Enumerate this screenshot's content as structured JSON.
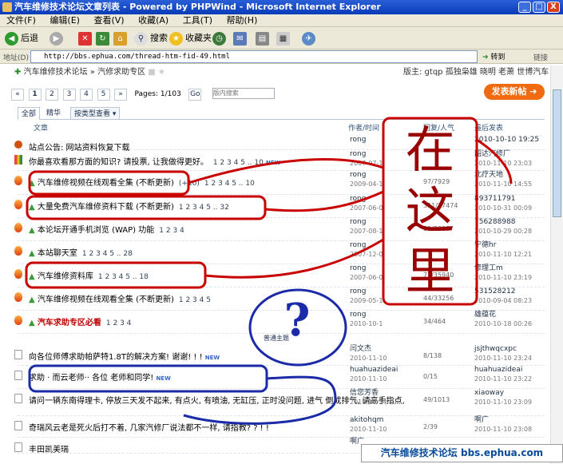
{
  "window": {
    "title": "汽车维修技术论坛文章列表 - Powered by PHPWind - Microsoft Internet Explorer",
    "min": "_",
    "max": "□",
    "close": "X"
  },
  "menu": [
    "文件(F)",
    "编辑(E)",
    "查看(V)",
    "收藏(A)",
    "工具(T)",
    "帮助(H)"
  ],
  "toolbar": {
    "back": "后退",
    "search": "搜索",
    "favorites": "收藏夹"
  },
  "address": {
    "label": "地址(D)",
    "url": "http://bbs.ephua.com/thread-htm-fid-49.html",
    "go": "转到",
    "links": "链接"
  },
  "breadcrumb": {
    "forum": "汽车维修技术论坛",
    "sep": "»",
    "board": "汽修求助专区"
  },
  "moderators": "版主: gtqp 孤独枭雄 晓明 老萧 世博汽车",
  "pager": {
    "pages": [
      "1",
      "2",
      "3",
      "4",
      "5"
    ],
    "next": "»",
    "info": "Pages: 1/103",
    "go": "Go",
    "search_placeholder": "版内搜索"
  },
  "new_post": "发表新帖",
  "tabs": {
    "all": "全部",
    "digest": "精华",
    "by_type": "按类型查看"
  },
  "headers": {
    "article": "文章",
    "author": "作者/时间",
    "replies": "回复/人气",
    "last": "最后发表"
  },
  "rows": [
    {
      "title": "站点公告: 网站资料恢复下载",
      "author": "rong",
      "date": "",
      "replies": "",
      "last_user": "2010-10-10 19:25",
      "last_date": ""
    },
    {
      "title": "你最喜欢看那方面的知识? 请投票, 让我做得更好。",
      "pages": "1 2 3 4 5 .. 10",
      "author": "rong",
      "date": "2007-07-1",
      "replies": "",
      "last_user": "韶达汽修厂",
      "last_date": "2010-11-10 23:03"
    },
    {
      "title": "汽车维修视频在线观看全集 (不断更新)",
      "extra": "(+10)",
      "pages": "1 2 3 4 5 .. 10",
      "author": "rong",
      "date": "2009-04-1",
      "replies": "97/7929",
      "last_user": "北疗天地",
      "last_date": "2010-11-10 14:55"
    },
    {
      "title": "大量免费汽车维修资料下载 (不断更新)",
      "pages": "1 2 3 4 5 .. 32",
      "author": "rong",
      "date": "2007-06-0",
      "replies": "311/27474",
      "last_user": "893711791",
      "last_date": "2010-10-31 00:09"
    },
    {
      "title": "本论坛开通手机浏览 (WAP) 功能",
      "pages": "1 2 3 4",
      "author": "rong",
      "date": "2007-08-1",
      "replies": "31/3337",
      "last_user": "756288988",
      "last_date": "2010-10-29 00:28"
    },
    {
      "title": "本站聊天室",
      "pages": "1 2 3 4 5 .. 28",
      "author": "rong",
      "date": "2007-12-0",
      "replies": "",
      "last_user": "宁德hr",
      "last_date": "2010-11-10 12:21"
    },
    {
      "title": "汽车维修资料库",
      "pages": "1 2 3 4 5 .. 18",
      "author": "rong",
      "date": "2007-06-0",
      "replies": "77/35940",
      "last_user": "修理工m",
      "last_date": "2010-11-10 23:19"
    },
    {
      "title": "汽车维修视频在线观看全集 (不断更新)",
      "pages": "1 2 3 4 5",
      "author": "rong",
      "date": "2009-05-1",
      "replies": "44/33256",
      "last_user": "531528212",
      "last_date": "2010-09-04 08:23"
    },
    {
      "title": "汽车求助专区必看",
      "pages": "1 2 3 4",
      "author": "rong",
      "date": "2010-10-1",
      "replies": "34/464",
      "last_user": "雄蕴花",
      "last_date": "2010-10-18 00:26"
    },
    {
      "title": "向各位师傅求助帕萨特1.8T的解决方案! 谢谢! ! !",
      "author": "闫文杰",
      "date": "2010-11-10",
      "replies": "8/138",
      "last_user": "jsjthwqcxpc",
      "last_date": "2010-11-10 23:24"
    },
    {
      "title": "求助 · 而云老师·· 各位 老师和同学!",
      "author": "huahuazideai",
      "date": "2010-11-10",
      "replies": "0/15",
      "last_user": "huahuazideai",
      "last_date": "2010-11-10 23:22"
    },
    {
      "title": "请问一辆东南得理卡, 停放三天发不起来, 有点火, 有喷油, 无缸压, 正时没问题, 进气 倒成排气, 请高手指点,",
      "author": "信您芳香",
      "date": "2010-10-24",
      "replies": "49/1013",
      "last_user": "xiaoway",
      "last_date": "2010-11-10 23:09"
    },
    {
      "title": "奇瑞风云老是死火后打不着, 几家汽修厂说法都不一样, 请指教? ? ! !",
      "author": "akitohqm",
      "date": "2010-11-10",
      "replies": "2/39",
      "last_user": "啊广",
      "last_date": "2010-11-10 23:08"
    },
    {
      "title": "丰田凯美瑞",
      "author": "啊广",
      "date": "",
      "replies": "",
      "last_user": "",
      "last_date": ""
    }
  ],
  "normal_divider": "普通主题",
  "new_badge": "NEW",
  "annotation": {
    "chars": [
      "在",
      "这",
      "里"
    ],
    "question": "?"
  },
  "footer": "汽车维修技术论坛 bbs.ephua.com"
}
